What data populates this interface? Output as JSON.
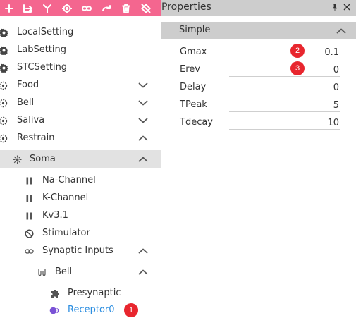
{
  "toolbar": {
    "buttons": [
      "add-icon",
      "export-icon",
      "filter-icon",
      "target-icon",
      "link-icon",
      "redo-icon",
      "delete-icon",
      "disable-icon"
    ]
  },
  "tree": {
    "items": [
      {
        "label": "LocalSetting",
        "icon": "gear-icon"
      },
      {
        "label": "LabSetting",
        "icon": "gear-icon"
      },
      {
        "label": "STCSetting",
        "icon": "gear-icon"
      },
      {
        "label": "Food",
        "icon": "stimulus-icon",
        "expander": "collapsed"
      },
      {
        "label": "Bell",
        "icon": "stimulus-icon",
        "expander": "collapsed"
      },
      {
        "label": "Saliva",
        "icon": "stimulus-icon",
        "expander": "collapsed"
      },
      {
        "label": "Restrain",
        "icon": "stimulus-icon",
        "expander": "expanded"
      },
      {
        "label": "Soma",
        "icon": "soma-icon",
        "expander": "expanded",
        "selected": true
      },
      {
        "label": "Na-Channel",
        "icon": "channel-icon"
      },
      {
        "label": "K-Channel",
        "icon": "channel-icon"
      },
      {
        "label": "Kv3.1",
        "icon": "channel-icon"
      },
      {
        "label": "Stimulator",
        "icon": "stimulator-icon"
      },
      {
        "label": "Synaptic Inputs",
        "icon": "link-icon",
        "expander": "expanded"
      },
      {
        "label": "Bell",
        "icon": "synapse-icon",
        "expander": "expanded"
      },
      {
        "label": "Presynaptic",
        "icon": "puzzle-icon"
      },
      {
        "label": "Receptor0",
        "icon": "receptor-icon",
        "highlight": true
      }
    ],
    "receptor_badge": "1"
  },
  "properties": {
    "title": "Properties",
    "section": "Simple",
    "rows": [
      {
        "name": "Gmax",
        "value": "0.1",
        "badge": "2"
      },
      {
        "name": "Erev",
        "value": "0",
        "badge": "3"
      },
      {
        "name": "Delay",
        "value": "0"
      },
      {
        "name": "TPeak",
        "value": "5"
      },
      {
        "name": "Tdecay",
        "value": "10"
      }
    ]
  },
  "colors": {
    "toolbar": "#f4668f",
    "header": "#cdcdcd",
    "selection": "#e2e2e2",
    "badge": "#e8262e",
    "link": "#2b8de0",
    "receptor_dot": "#7a52d6"
  }
}
